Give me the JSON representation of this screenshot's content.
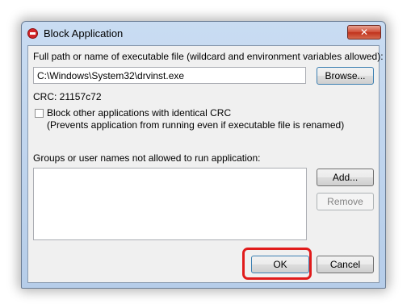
{
  "window": {
    "title": "Block Application",
    "close_glyph": "✕"
  },
  "path": {
    "label": "Full path or name of executable file (wildcard and environment variables allowed):",
    "value": "C:\\Windows\\System32\\drvinst.exe",
    "browse_label": "Browse..."
  },
  "crc": {
    "text": "CRC: 21157c72"
  },
  "block_crc": {
    "label": "Block other applications with identical CRC",
    "note": "(Prevents application from running even if executable file is renamed)",
    "checked": false
  },
  "groups": {
    "label": "Groups or user names not allowed to run application:",
    "items": [],
    "add_label": "Add...",
    "remove_label": "Remove"
  },
  "footer": {
    "ok_label": "OK",
    "cancel_label": "Cancel"
  },
  "colors": {
    "highlight": "#e11b1b",
    "title_icon": "#d3262a"
  }
}
